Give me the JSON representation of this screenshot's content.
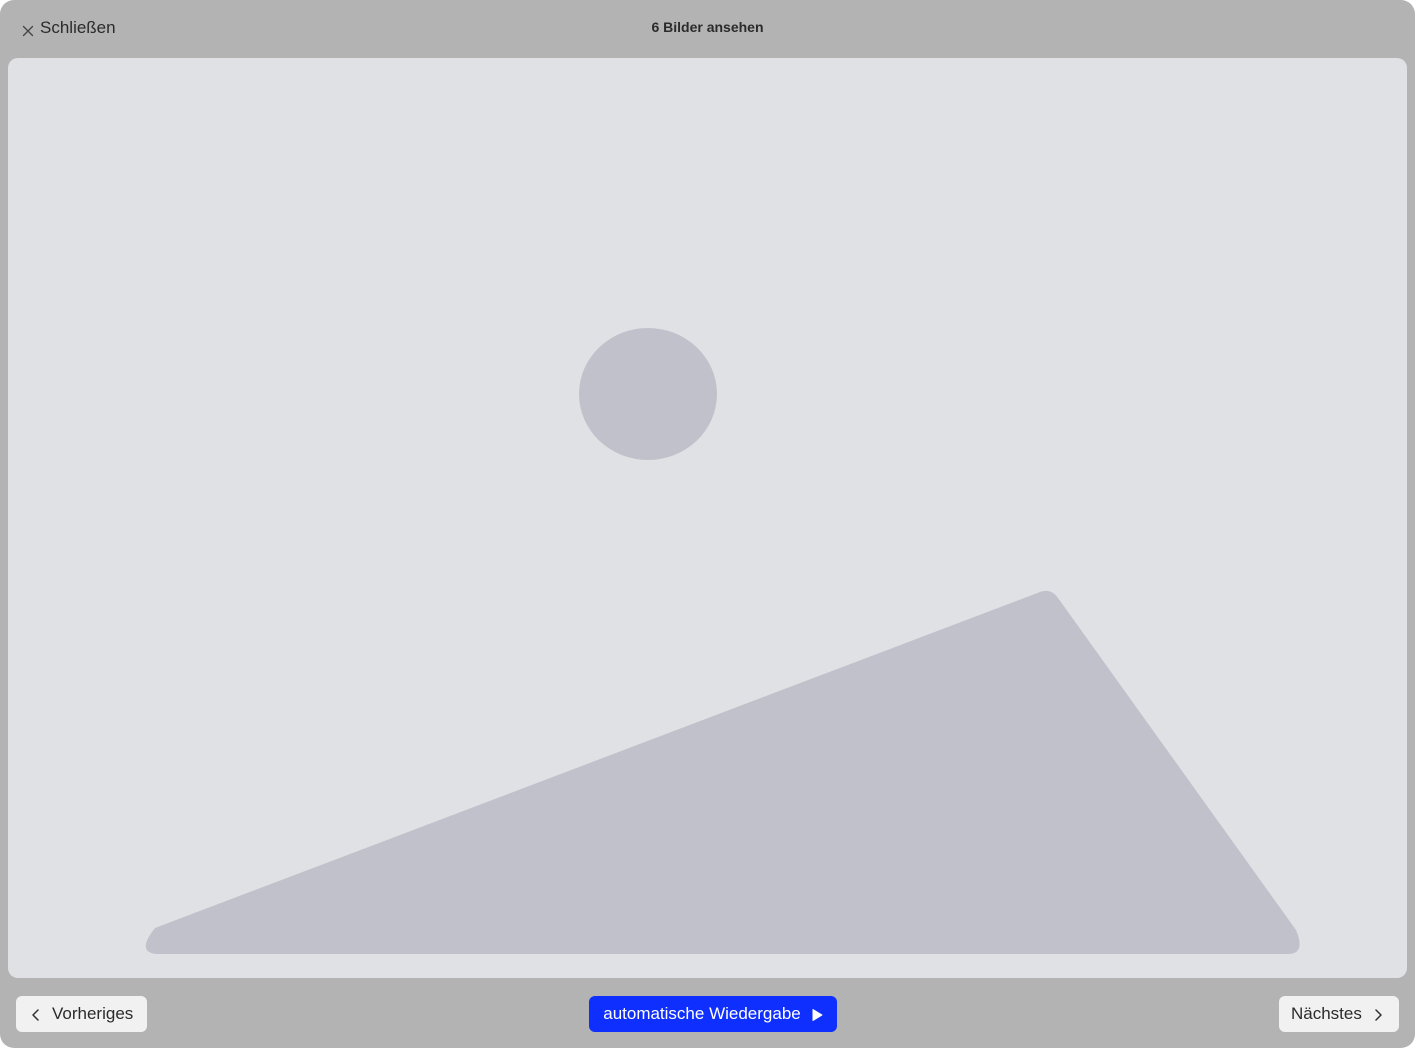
{
  "header": {
    "close_label": "Schließen",
    "title": "6 Bilder ansehen"
  },
  "image": {
    "placeholder_fill": "#c1c1cb",
    "background": "#e0e1e5"
  },
  "footer": {
    "prev_label": "Vorheriges",
    "autoplay_label": "automatische Wiedergabe",
    "next_label": "Nächstes"
  },
  "colors": {
    "overlay": "#b3b3b3",
    "accent": "#0f2fff",
    "button_bg": "#f1f1f1",
    "text": "#2b2b2b"
  },
  "icons": {
    "close": "close-icon",
    "prev": "chevron-left-icon",
    "next": "chevron-right-icon",
    "play": "play-icon"
  }
}
